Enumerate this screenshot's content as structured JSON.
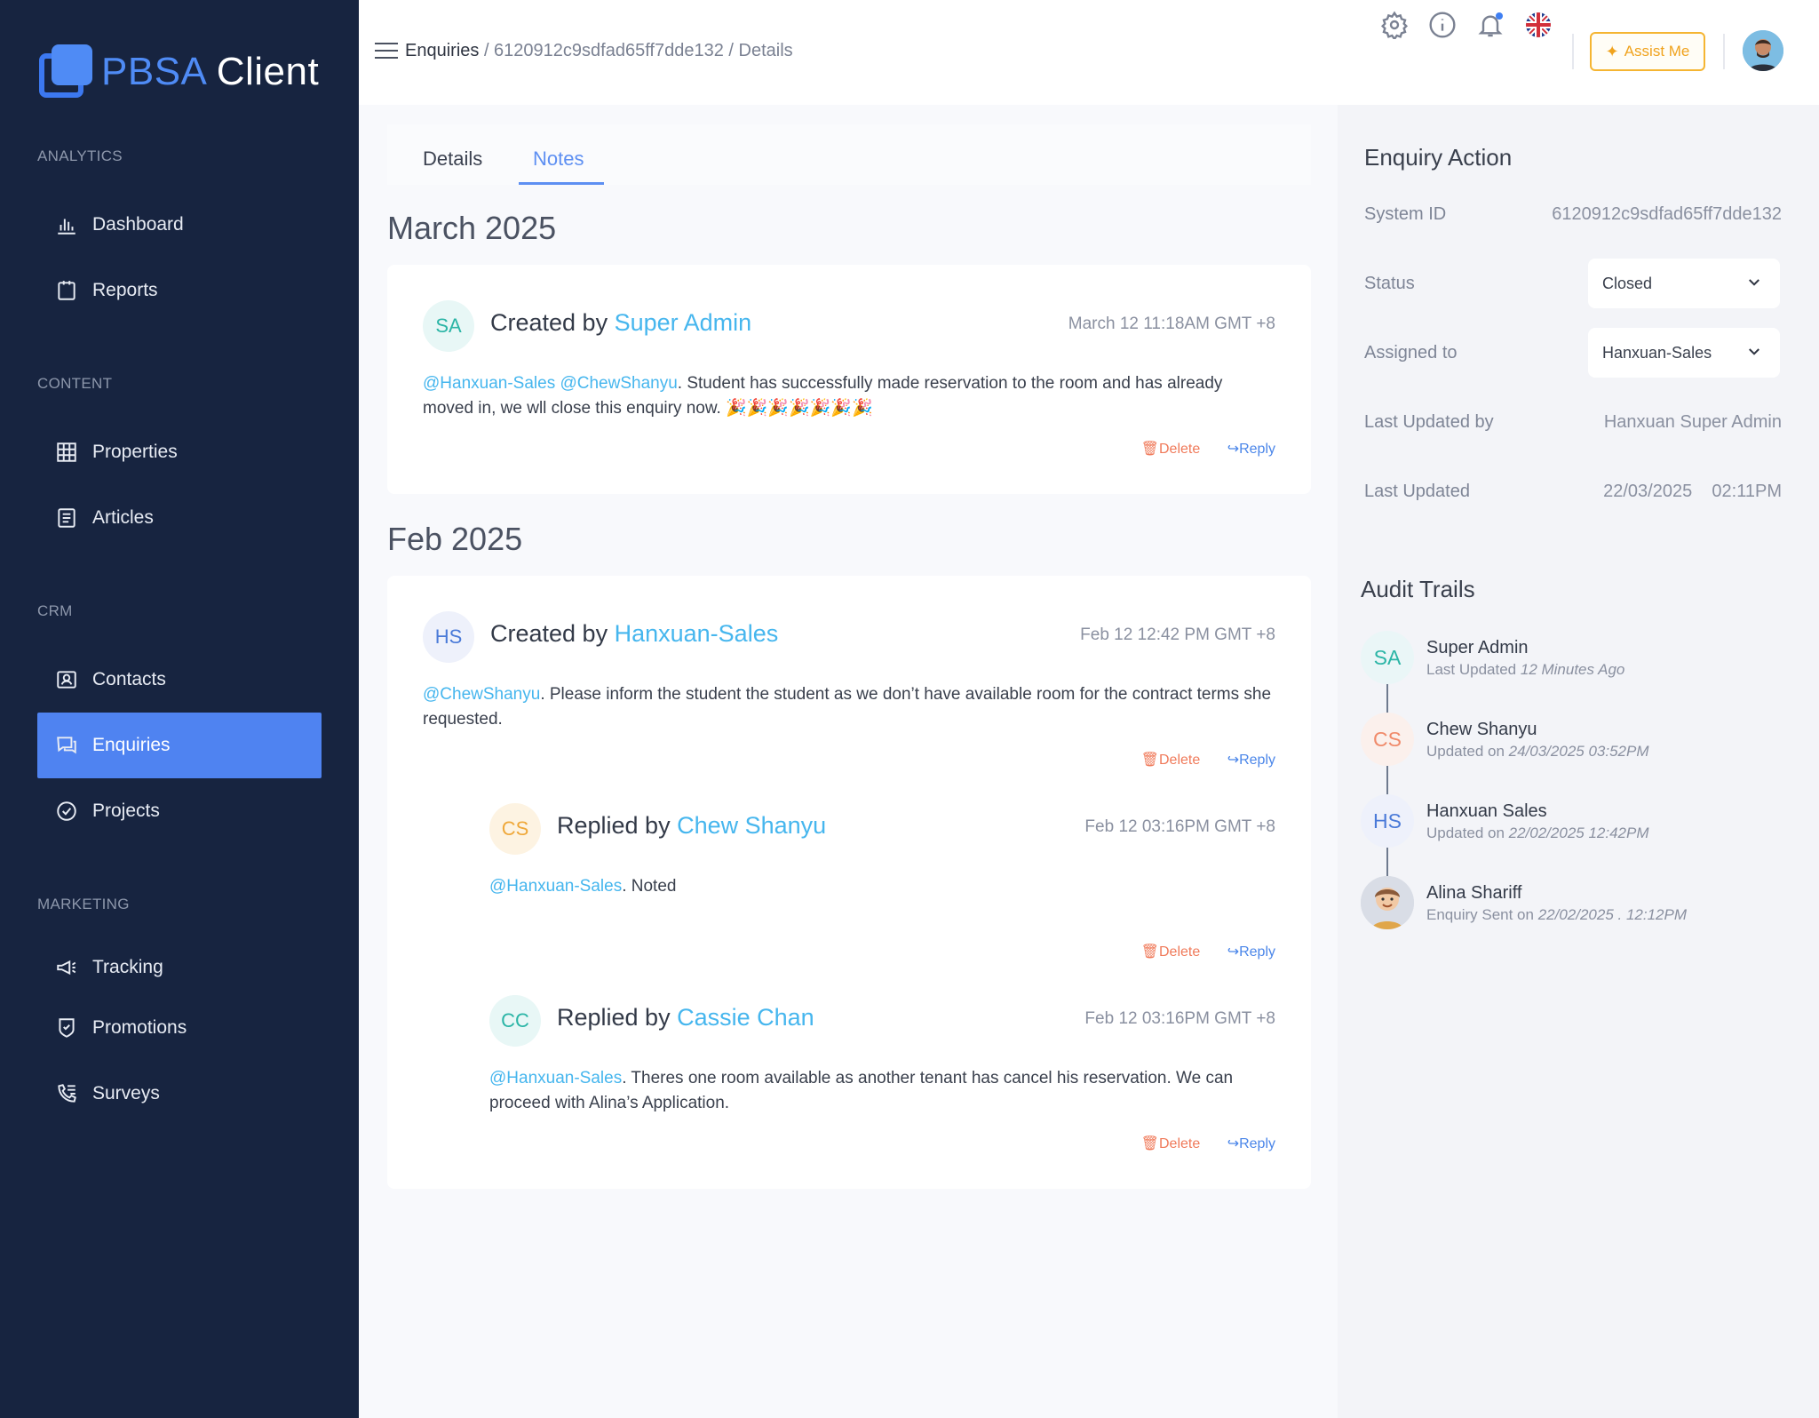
{
  "brand": {
    "part1": "PBSA",
    "part2": "Client"
  },
  "sidebar": {
    "sections": [
      {
        "label": "ANALYTICS"
      },
      {
        "label": "CONTENT"
      },
      {
        "label": "CRM"
      },
      {
        "label": "MARKETING"
      }
    ],
    "items": [
      {
        "label": "Dashboard",
        "icon": "bar-chart-icon"
      },
      {
        "label": "Reports",
        "icon": "clipboard-icon"
      },
      {
        "label": "Properties",
        "icon": "building-icon"
      },
      {
        "label": "Articles",
        "icon": "document-icon"
      },
      {
        "label": "Contacts",
        "icon": "contact-card-icon"
      },
      {
        "label": "Enquiries",
        "icon": "chat-icon",
        "active": true
      },
      {
        "label": "Projects",
        "icon": "check-circle-icon"
      },
      {
        "label": "Tracking",
        "icon": "megaphone-icon"
      },
      {
        "label": "Promotions",
        "icon": "shield-check-icon"
      },
      {
        "label": "Surveys",
        "icon": "phone-list-icon"
      }
    ]
  },
  "header": {
    "breadcrumb": {
      "root": "Enquiries",
      "rest": " / 6120912c9sdfad65ff7dde132 / Details"
    },
    "assist_label": "Assist Me",
    "colors": {
      "accent": "#4f83f1",
      "assist": "#f5b532",
      "mention": "#46b6ee"
    }
  },
  "tabs": [
    {
      "label": "Details"
    },
    {
      "label": "Notes",
      "active": true
    }
  ],
  "months": [
    "March 2025",
    "Feb 2025"
  ],
  "notes": [
    {
      "initials": "SA",
      "verb": "Created by",
      "author": "Super Admin",
      "time": "March 12  11:18AM GMT +8",
      "mentions": "@Hanxuan-Sales @ChewShanyu",
      "text": ". Student has successfully made reservation to the room and has already moved in, we wll close this enquiry now. 🎉🎉🎉🎉🎉🎉🎉",
      "delete": "Delete",
      "reply": "Reply"
    },
    {
      "initials": "HS",
      "verb": "Created by",
      "author": "Hanxuan-Sales",
      "time": "Feb 12  12:42 PM GMT +8",
      "mentions": "@ChewShanyu",
      "text": ". Please inform the student the student as we don’t have available room for the contract terms she requested.",
      "delete": "Delete",
      "reply": "Reply"
    },
    {
      "initials": "CS",
      "verb": "Replied by",
      "author": "Chew Shanyu",
      "time": "Feb 12  03:16PM GMT +8",
      "mentions": "@Hanxuan-Sales",
      "text": ". Noted",
      "delete": "Delete",
      "reply": "Reply"
    },
    {
      "initials": "CC",
      "verb": "Replied by",
      "author": "Cassie Chan",
      "time": "Feb 12  03:16PM GMT +8",
      "mentions": "@Hanxuan-Sales",
      "text": ". Theres one room available as another tenant has cancel his reservation. We can proceed with Alina’s Application.",
      "delete": "Delete",
      "reply": "Reply"
    }
  ],
  "enquiry_action": {
    "title": "Enquiry Action",
    "system_id_label": "System ID",
    "system_id": "6120912c9sdfad65ff7dde132",
    "status_label": "Status",
    "status": "Closed",
    "assigned_label": "Assigned to",
    "assigned": "Hanxuan-Sales",
    "updated_by_label": "Last Updated by",
    "updated_by": "Hanxuan Super Admin",
    "updated_label": "Last Updated",
    "updated": "22/03/2025    02:11PM"
  },
  "audit": {
    "title": "Audit Trails",
    "items": [
      {
        "initials": "SA",
        "name": "Super Admin",
        "prefix": "Last Updated ",
        "when": "12 Minutes Ago"
      },
      {
        "initials": "CS",
        "name": "Chew Shanyu",
        "prefix": "Updated on ",
        "when": "24/03/2025  03:52PM"
      },
      {
        "initials": "HS",
        "name": "Hanxuan Sales",
        "prefix": "Updated on ",
        "when": "22/02/2025  12:42PM"
      },
      {
        "initials": "",
        "name": "Alina Shariff",
        "prefix": "Enquiry Sent on ",
        "when": "22/02/2025 . 12:12PM"
      }
    ]
  }
}
